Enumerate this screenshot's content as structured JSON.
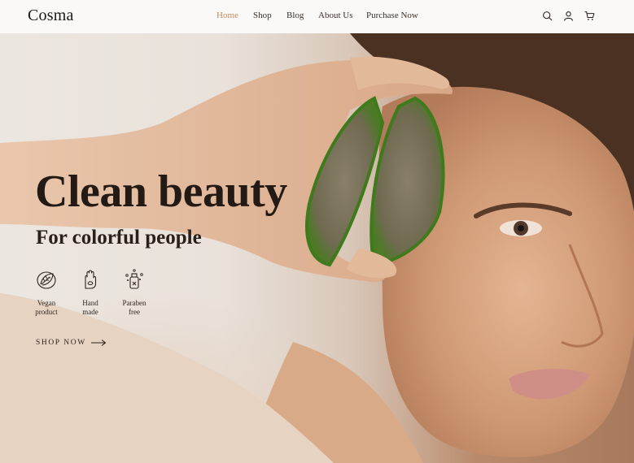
{
  "brand": "Cosma",
  "nav": {
    "links": [
      "Home",
      "Shop",
      "Blog",
      "About Us",
      "Purchase Now"
    ],
    "active_index": 0,
    "icons": [
      "search-icon",
      "user-icon",
      "cart-icon"
    ]
  },
  "hero": {
    "title": "Clean beauty",
    "subtitle": "For colorful people",
    "features": [
      {
        "icon": "leaf-icon",
        "label": "Vegan\nproduct"
      },
      {
        "icon": "hand-icon",
        "label": "Hand\nmade"
      },
      {
        "icon": "bottle-icon",
        "label": "Paraben\nfree"
      }
    ],
    "cta_label": "SHOP NOW",
    "cta_icon": "arrow-right-icon"
  },
  "colors": {
    "accent": "#c08b5c",
    "text_dark": "#241a15",
    "nav_bg": "#fbf9f7"
  }
}
